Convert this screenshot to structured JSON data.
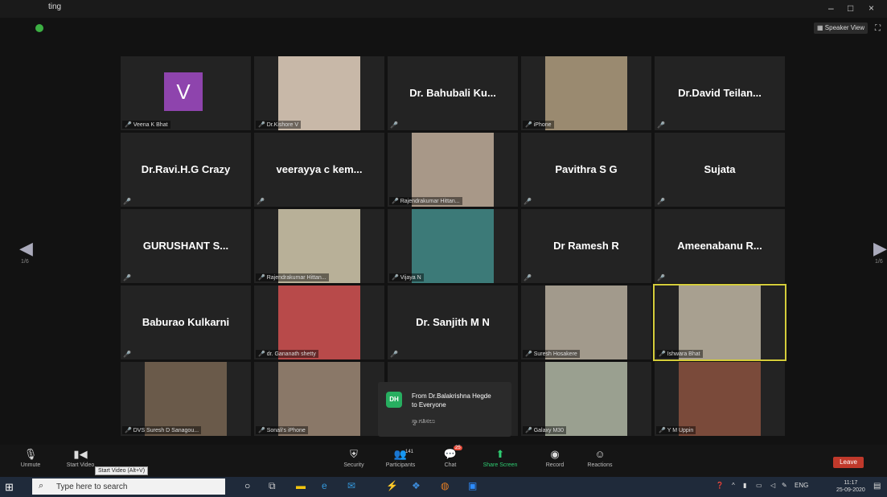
{
  "window": {
    "title": "ting",
    "speaker_view": "Speaker View",
    "minimize": "–",
    "maximize": "□",
    "close": "×"
  },
  "nav": {
    "left_page": "1/6",
    "right_page": "1/6"
  },
  "participants": [
    {
      "display": "V",
      "label": "Veena K Bhat",
      "type": "avatar"
    },
    {
      "label": "Dr.Kishore V",
      "type": "video",
      "color": "#c8b8a8"
    },
    {
      "display": "Dr. Bahubali Ku...",
      "label": "",
      "type": "name"
    },
    {
      "label": "iPhone",
      "type": "video",
      "color": "#9a8a70"
    },
    {
      "display": "Dr.David Teilan...",
      "label": "",
      "type": "name"
    },
    {
      "display": "Dr.Ravi.H.G Crazy",
      "label": "",
      "type": "name"
    },
    {
      "display": "veerayya c kem...",
      "label": "",
      "type": "name"
    },
    {
      "label": "Rajendrakumar Hittan...",
      "type": "video",
      "color": "#a89888"
    },
    {
      "display": "Pavithra S G",
      "label": "",
      "type": "name"
    },
    {
      "display": "Sujata",
      "label": "",
      "type": "name"
    },
    {
      "display": "GURUSHANT S...",
      "label": "",
      "type": "name"
    },
    {
      "label": "Rajendrakumar Hittan...",
      "type": "video",
      "color": "#b8b098"
    },
    {
      "label": "Vijaya N",
      "type": "video",
      "color": "#3c7a78"
    },
    {
      "display": "Dr Ramesh R",
      "label": "",
      "type": "name"
    },
    {
      "display": "Ameenabanu R...",
      "label": "",
      "type": "name"
    },
    {
      "display": "Baburao Kulkarni",
      "label": "",
      "type": "name"
    },
    {
      "label": "dr. Gananath shetty",
      "type": "video",
      "color": "#b84a4a"
    },
    {
      "display": "Dr. Sanjith M N",
      "label": "",
      "type": "name"
    },
    {
      "label": "Suresh Hosakere",
      "type": "video",
      "color": "#a29a8c"
    },
    {
      "label": "Ishwara Bhat",
      "type": "video",
      "color": "#a8a090",
      "active": true
    },
    {
      "label": "DVS Suresh D Sanagou...",
      "type": "video",
      "color": "#6a5a4a"
    },
    {
      "label": "Sonali's iPhone",
      "type": "video",
      "color": "#8a7868"
    },
    {
      "display": "",
      "label": "",
      "type": "blank"
    },
    {
      "label": "Galaxy M30",
      "type": "video",
      "color": "#9aa090"
    },
    {
      "label": "Y M Uppin",
      "type": "video",
      "color": "#7a4a3a"
    }
  ],
  "chat_popup": {
    "initials": "DH",
    "from": "From Dr.Balakrishna Hegde",
    "to": "to Everyone",
    "message": "ಸ್ವಾಗತಿಸಲು"
  },
  "toolbar": {
    "unmute": "Unmute",
    "start_video": "Start Video",
    "tooltip": "Start Video (Alt+V)",
    "security": "Security",
    "participants": "Participants",
    "participants_count": "141",
    "chat": "Chat",
    "chat_badge": "25",
    "share_screen": "Share Screen",
    "record": "Record",
    "reactions": "Reactions",
    "leave": "Leave"
  },
  "taskbar": {
    "search_placeholder": "Type here to search",
    "lang": "ENG",
    "time": "11:17",
    "date": "25-09-2020"
  }
}
